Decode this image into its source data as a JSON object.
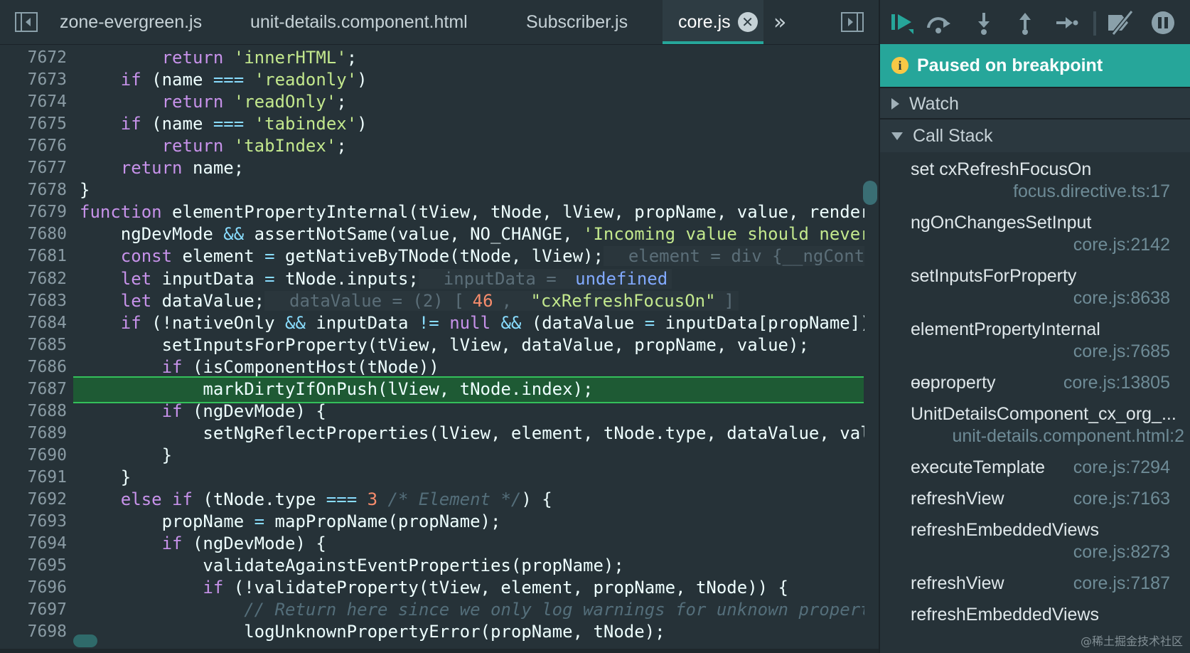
{
  "tabs": [
    {
      "label": "zone-evergreen.js",
      "active": false
    },
    {
      "label": "unit-details.component.html",
      "active": false
    },
    {
      "label": "Subscriber.js",
      "active": false
    },
    {
      "label": "core.js",
      "active": true
    }
  ],
  "tab_close_glyph": "✕",
  "tab_overflow_glyph": "»",
  "code": {
    "current_line": "7685",
    "lines": [
      {
        "n": "7672"
      },
      {
        "n": "7673"
      },
      {
        "n": "7674"
      },
      {
        "n": "7675"
      },
      {
        "n": "7676"
      },
      {
        "n": "7677"
      },
      {
        "n": "7678"
      },
      {
        "n": "7679"
      },
      {
        "n": "7680"
      },
      {
        "n": "7681"
      },
      {
        "n": "7682"
      },
      {
        "n": "7683"
      },
      {
        "n": "7684"
      },
      {
        "n": "7685"
      },
      {
        "n": "7686"
      },
      {
        "n": "7687"
      },
      {
        "n": "7688"
      },
      {
        "n": "7689"
      },
      {
        "n": "7690"
      },
      {
        "n": "7691"
      },
      {
        "n": "7692"
      },
      {
        "n": "7693"
      },
      {
        "n": "7694"
      },
      {
        "n": "7695"
      },
      {
        "n": "7696"
      },
      {
        "n": "7697"
      },
      {
        "n": "7698"
      }
    ],
    "tokens": {
      "l7672": [
        "        ",
        "return",
        " ",
        "'innerHTML'",
        ";"
      ],
      "l7673": [
        "    ",
        "if",
        " (name ",
        "===",
        " ",
        "'readonly'",
        ")"
      ],
      "l7674": [
        "        ",
        "return",
        " ",
        "'readOnly'",
        ";"
      ],
      "l7675": [
        "    ",
        "if",
        " (name ",
        "===",
        " ",
        "'tabindex'",
        ")"
      ],
      "l7676": [
        "        ",
        "return",
        " ",
        "'tabIndex'",
        ";"
      ],
      "l7677": [
        "    ",
        "return",
        " name;"
      ],
      "l7678": [
        "}"
      ],
      "l7679": [
        "function",
        " elementPropertyInternal(tView, tNode, lView, propName, value, render"
      ],
      "l7680": [
        "    ngDevMode ",
        "&&",
        " assertNotSame(value, NO_CHANGE, ",
        "'Incoming value should never"
      ],
      "l7681": [
        "    ",
        "const",
        " element ",
        "=",
        " getNativeByTNode(tNode, lView);",
        "  element = div {__ngConte"
      ],
      "l7682": [
        "    ",
        "let",
        " inputData ",
        "=",
        " tNode.inputs;",
        "  inputData = ",
        "undefined"
      ],
      "l7683": [
        "    ",
        "let",
        " dataValue;",
        "  dataValue = (2) [",
        "46",
        ", ",
        "\"cxRefreshFocusOn\"",
        "]"
      ],
      "l7684": [
        "    ",
        "if",
        " (!nativeOnly ",
        "&&",
        " inputData ",
        "!=",
        " ",
        "null",
        " ",
        "&&",
        " (dataValue ",
        "=",
        " inputData[propName])"
      ],
      "l7685": [
        "        setInputsForProperty(tView, lView, dataValue, propName, value);"
      ],
      "l7686": [
        "        ",
        "if",
        " (isComponentHost(tNode))"
      ],
      "l7687": [
        "            markDirtyIfOnPush(lView, tNode.index);"
      ],
      "l7688": [
        "        ",
        "if",
        " (ngDevMode) {"
      ],
      "l7689": [
        "            setNgReflectProperties(lView, element, tNode.type, dataValue, val"
      ],
      "l7690": [
        "        }"
      ],
      "l7691": [
        "    }"
      ],
      "l7692": [
        "    ",
        "else",
        " ",
        "if",
        " (tNode.type ",
        "===",
        " ",
        "3",
        " ",
        "/* Element */",
        ") {"
      ],
      "l7693": [
        "        propName ",
        "=",
        " mapPropName(propName);"
      ],
      "l7694": [
        "        ",
        "if",
        " (ngDevMode) {"
      ],
      "l7695": [
        "            validateAgainstEventProperties(propName);"
      ],
      "l7696": [
        "            ",
        "if",
        " (!validateProperty(tView, element, propName, tNode)) {"
      ],
      "l7697": [
        "                ",
        "// Return here since we only log warnings for unknown propert"
      ],
      "l7698": [
        "                logUnknownPropertyError(propName, tNode);"
      ]
    }
  },
  "debugger": {
    "toolbar": [
      "resume-icon",
      "step-over-icon",
      "step-into-icon",
      "step-out-icon",
      "step-icon",
      "deactivate-breakpoints-icon",
      "pause-on-exceptions-icon"
    ],
    "paused_message": "Paused on breakpoint",
    "paused_icon_glyph": "i",
    "watch_label": "Watch",
    "callstack_label": "Call Stack",
    "call_stack": [
      {
        "name": "set cxRefreshFocusOn",
        "location": "focus.directive.ts:17"
      },
      {
        "name": "ngOnChangesSetInput",
        "location": "core.js:2142"
      },
      {
        "name": "setInputsForProperty",
        "location": "core.js:8638"
      },
      {
        "name": "elementPropertyInternal",
        "location": "core.js:7685"
      },
      {
        "name": "ɵɵproperty",
        "location": "core.js:13805"
      },
      {
        "name": "UnitDetailsComponent_cx_org_...",
        "location": "unit-details.component.html:2"
      },
      {
        "name": "executeTemplate",
        "location": "core.js:7294"
      },
      {
        "name": "refreshView",
        "location": "core.js:7163"
      },
      {
        "name": "refreshEmbeddedViews",
        "location": "core.js:8273"
      },
      {
        "name": "refreshView",
        "location": "core.js:7187"
      },
      {
        "name": "refreshEmbeddedViews",
        "location": ""
      }
    ]
  },
  "watermark": "@稀土掘金技术社区",
  "colors": {
    "accent": "#26a69a",
    "current_line": "#1e5a34",
    "keyword": "#c792ea",
    "string": "#c3e88d",
    "number": "#f78c6c"
  }
}
